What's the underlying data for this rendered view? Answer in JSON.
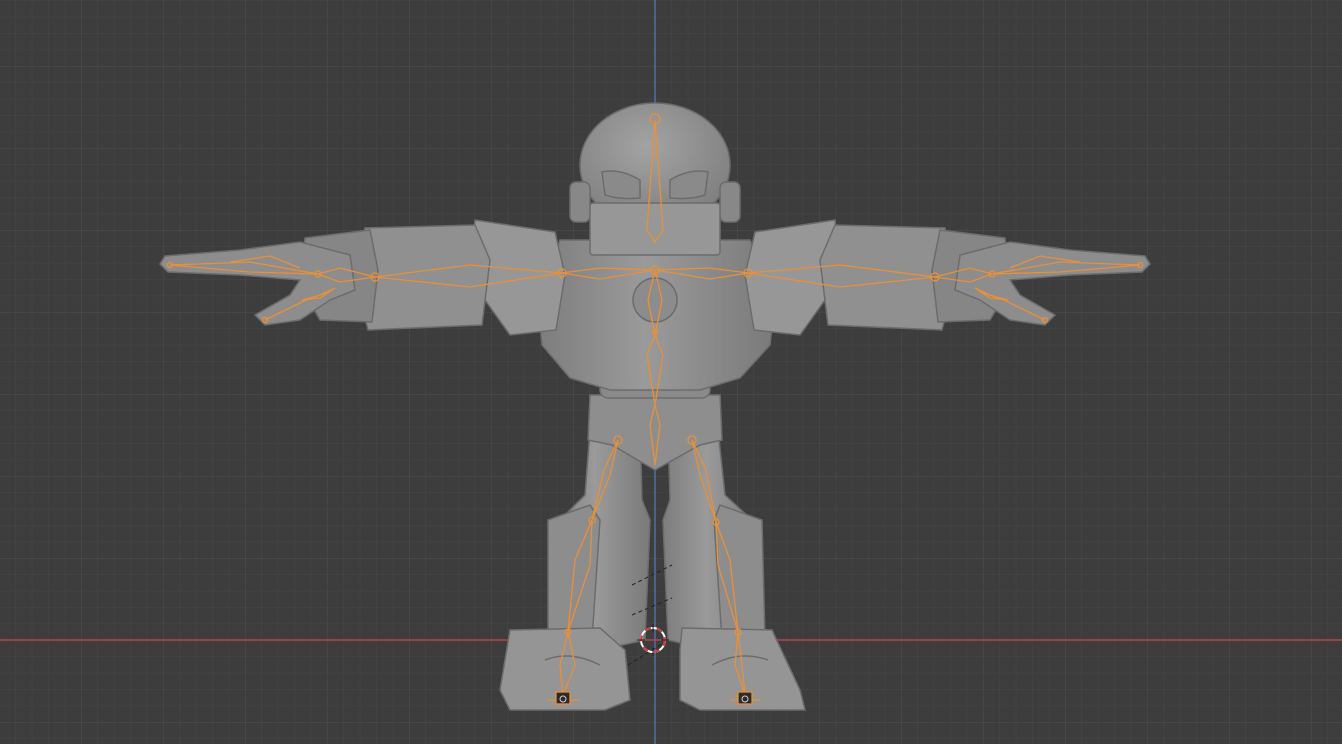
{
  "viewport": {
    "background_color": "#3d3d3d",
    "grid_minor_color": "#464646",
    "grid_major_color": "#505050",
    "x_axis_color": "#b5434f",
    "z_axis_color": "#4b6fb0",
    "mesh_color": "#8f8f8f",
    "mesh_shadow_color": "#6a6a6a",
    "armature_outline_color": "#e8903a",
    "cursor_icon": "3d-cursor-icon"
  }
}
